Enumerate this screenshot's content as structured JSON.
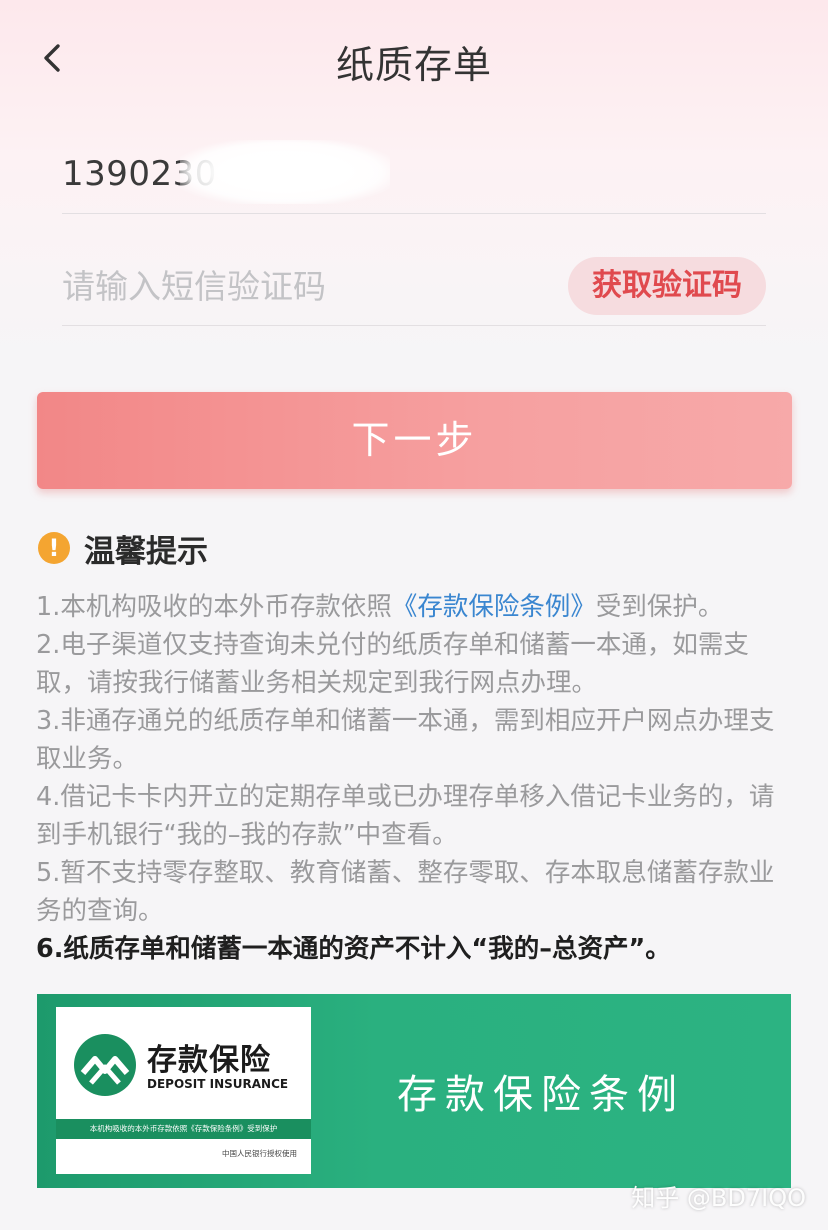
{
  "header": {
    "title": "纸质存单"
  },
  "form": {
    "phone_value": "1390230",
    "code_placeholder": "请输入短信验证码",
    "get_code_label": "获取验证码",
    "next_label": "下一步"
  },
  "tips": {
    "title": "温馨提示",
    "line1_pre": "1.本机构吸收的本外币存款依照",
    "line1_link": "《存款保险条例》",
    "line1_post": "受到保护。",
    "line2": "2.电子渠道仅支持查询未兑付的纸质存单和储蓄一本通，如需支取，请按我行储蓄业务相关规定到我行网点办理。",
    "line3": "3.非通存通兑的纸质存单和储蓄一本通，需到相应开户网点办理支取业务。",
    "line4": "4.借记卡卡内开立的定期存单或已办理存单移入借记卡业务的，请到手机银行“我的–我的存款”中查看。",
    "line5": "5.暂不支持零存整取、教育储蓄、整存零取、存本取息储蓄存款业务的查询。",
    "line6": "6.纸质存单和储蓄一本通的资产不计入“我的–总资产”。"
  },
  "banner": {
    "brand_cn": "存款保险",
    "brand_en": "DEPOSIT INSURANCE",
    "strip_text": "本机构吸收的本外币存款依照《存款保险条例》受到保护",
    "foot_text": "中国人民银行授权使用",
    "title": "存款保险条例"
  },
  "watermark": "知乎 @BD7IQO",
  "colors": {
    "accent": "#e04a4e",
    "button_start": "#f28787",
    "link": "#3a86d0",
    "warning": "#f4a531",
    "banner_green": "#2ab07f"
  }
}
